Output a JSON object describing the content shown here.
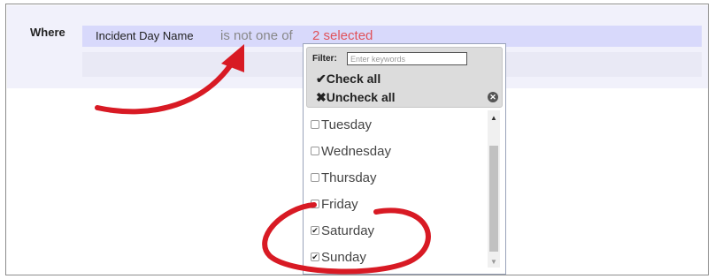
{
  "where": {
    "label": "Where",
    "field": "Incident Day Name",
    "operator": "is not one of",
    "selected_summary": "2 selected"
  },
  "dropdown": {
    "filter_label": "Filter:",
    "filter_placeholder": "Enter keywords",
    "filter_value": "",
    "check_all": "✔Check all",
    "uncheck_all": "✖Uncheck all",
    "items": [
      {
        "label": "Tuesday",
        "checked": false
      },
      {
        "label": "Wednesday",
        "checked": false
      },
      {
        "label": "Thursday",
        "checked": false
      },
      {
        "label": "Friday",
        "checked": false
      },
      {
        "label": "Saturday",
        "checked": true
      },
      {
        "label": "Sunday",
        "checked": true
      }
    ]
  },
  "colors": {
    "accent_red": "#e0525a",
    "annotation_red": "#d81a24",
    "row_highlight": "#d8d9fb"
  }
}
